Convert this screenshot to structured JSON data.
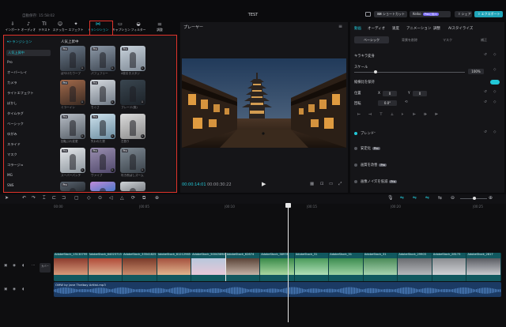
{
  "titlebar": {
    "autosave": "自動保存: 15:58:02",
    "project_title": "TEST",
    "shortcut": "ショートカット",
    "keyframe": "Keiko",
    "pro_join": "Proに加入",
    "share": "シェア",
    "export": "エクスポート"
  },
  "media_tabs": [
    {
      "label": "インポート",
      "icon": "import-icon",
      "glyph": "⇩"
    },
    {
      "label": "オーディオ",
      "icon": "audio-icon",
      "glyph": "♪"
    },
    {
      "label": "テキスト",
      "icon": "text-icon",
      "glyph": "TI"
    },
    {
      "label": "ステッカー",
      "icon": "sticker-icon",
      "glyph": "☺"
    },
    {
      "label": "エフェクト",
      "icon": "effect-icon",
      "glyph": "✦"
    },
    {
      "label": "トランジション",
      "icon": "transition-icon",
      "glyph": "⋈"
    },
    {
      "label": "キャプション",
      "icon": "caption-icon",
      "glyph": "▭"
    },
    {
      "label": "フィルター",
      "icon": "filter-icon",
      "glyph": "◒"
    },
    {
      "label": "調整",
      "icon": "adjust-icon",
      "glyph": "⚌"
    }
  ],
  "categories": {
    "header": "▾トランジション",
    "items": [
      "人気上昇中",
      "Pro",
      "オーバーレイ",
      "カメラ",
      "ライトエフェクト",
      "ぼかし",
      "タイムラグ",
      "ベーシック",
      "ゆがみ",
      "スライド",
      "マスク",
      "コラージュ",
      "MG",
      "SNS"
    ]
  },
  "grid": {
    "title": "人気上昇中",
    "thumbs": [
      {
        "label": "ぼやけたウーブ",
        "pro": true
      },
      {
        "label": "パフュフリー",
        "pro": true
      },
      {
        "label": "4枚引きスタジ",
        "pro": true
      },
      {
        "label": "ミラーイン",
        "pro": true
      },
      {
        "label": "ちぐさ",
        "pro": true
      },
      {
        "label": "ブレード(風)",
        "pro": false
      },
      {
        "label": "回転ぶれ変更",
        "pro": true
      },
      {
        "label": "失われた霧",
        "pro": true
      },
      {
        "label": "左割り",
        "pro": false
      },
      {
        "label": "スーパーパンチ",
        "pro": true
      },
      {
        "label": "ヴァイブ",
        "pro": true
      },
      {
        "label": "吹き飛ばしズーム",
        "pro": true
      },
      {
        "label": "",
        "pro": true
      },
      {
        "label": "",
        "pro": false
      },
      {
        "label": "",
        "pro": false
      }
    ]
  },
  "player": {
    "title": "プレーヤー",
    "time_current": "00:00:14:01",
    "time_total": "00:00:30:22"
  },
  "inspector": {
    "tabs": [
      "動画",
      "オーディオ",
      "速度",
      "アニメーション",
      "調整",
      "AIスタイライズ"
    ],
    "subtabs": [
      "ベーシック",
      "背景を削除",
      "マスク",
      "補正"
    ],
    "keyframe_section": "キラキラ変身",
    "scale_label": "スケール",
    "scale_value": "100%",
    "aspect_lock_label": "縦横比を保持",
    "position_label": "位置",
    "position_x_label": "X",
    "position_x": "0",
    "position_y_label": "Y",
    "position_y": "0",
    "rotate_label": "回転",
    "rotate_value": "0.0°",
    "blend_label": "ブレンド",
    "stabilize_label": "安定化",
    "enhance_label": "画質を改善",
    "denoise_label": "画像ノイズを低減",
    "pro_chip": "Pro"
  },
  "timeline": {
    "ruler": [
      "00:00",
      "|00:05",
      "|00:10",
      "|00:15",
      "|00:20",
      "|00:25"
    ],
    "cover_label": "カバー",
    "audio_clip": "OMW by Jane Thelboy Artlist.mp3",
    "clips": [
      "AdobeStock_13130799",
      "AdobeStock_64023715",
      "AdobeStock_33541825",
      "AdobeStock_61212965",
      "AdobeStock_50043694",
      "AdobeStock_62674",
      "AdobeStock_38978",
      "AdobeStock_31",
      "AdobeStock_31",
      "AdobeStock_31",
      "AdobeStock_29903",
      "AdobeStock_28173",
      "AdobeStock_2817"
    ]
  },
  "colors": {
    "accent": "#22c8d8",
    "highlight": "#e0332a",
    "video_track": "#11585f",
    "audio_track": "#1b3a63"
  }
}
